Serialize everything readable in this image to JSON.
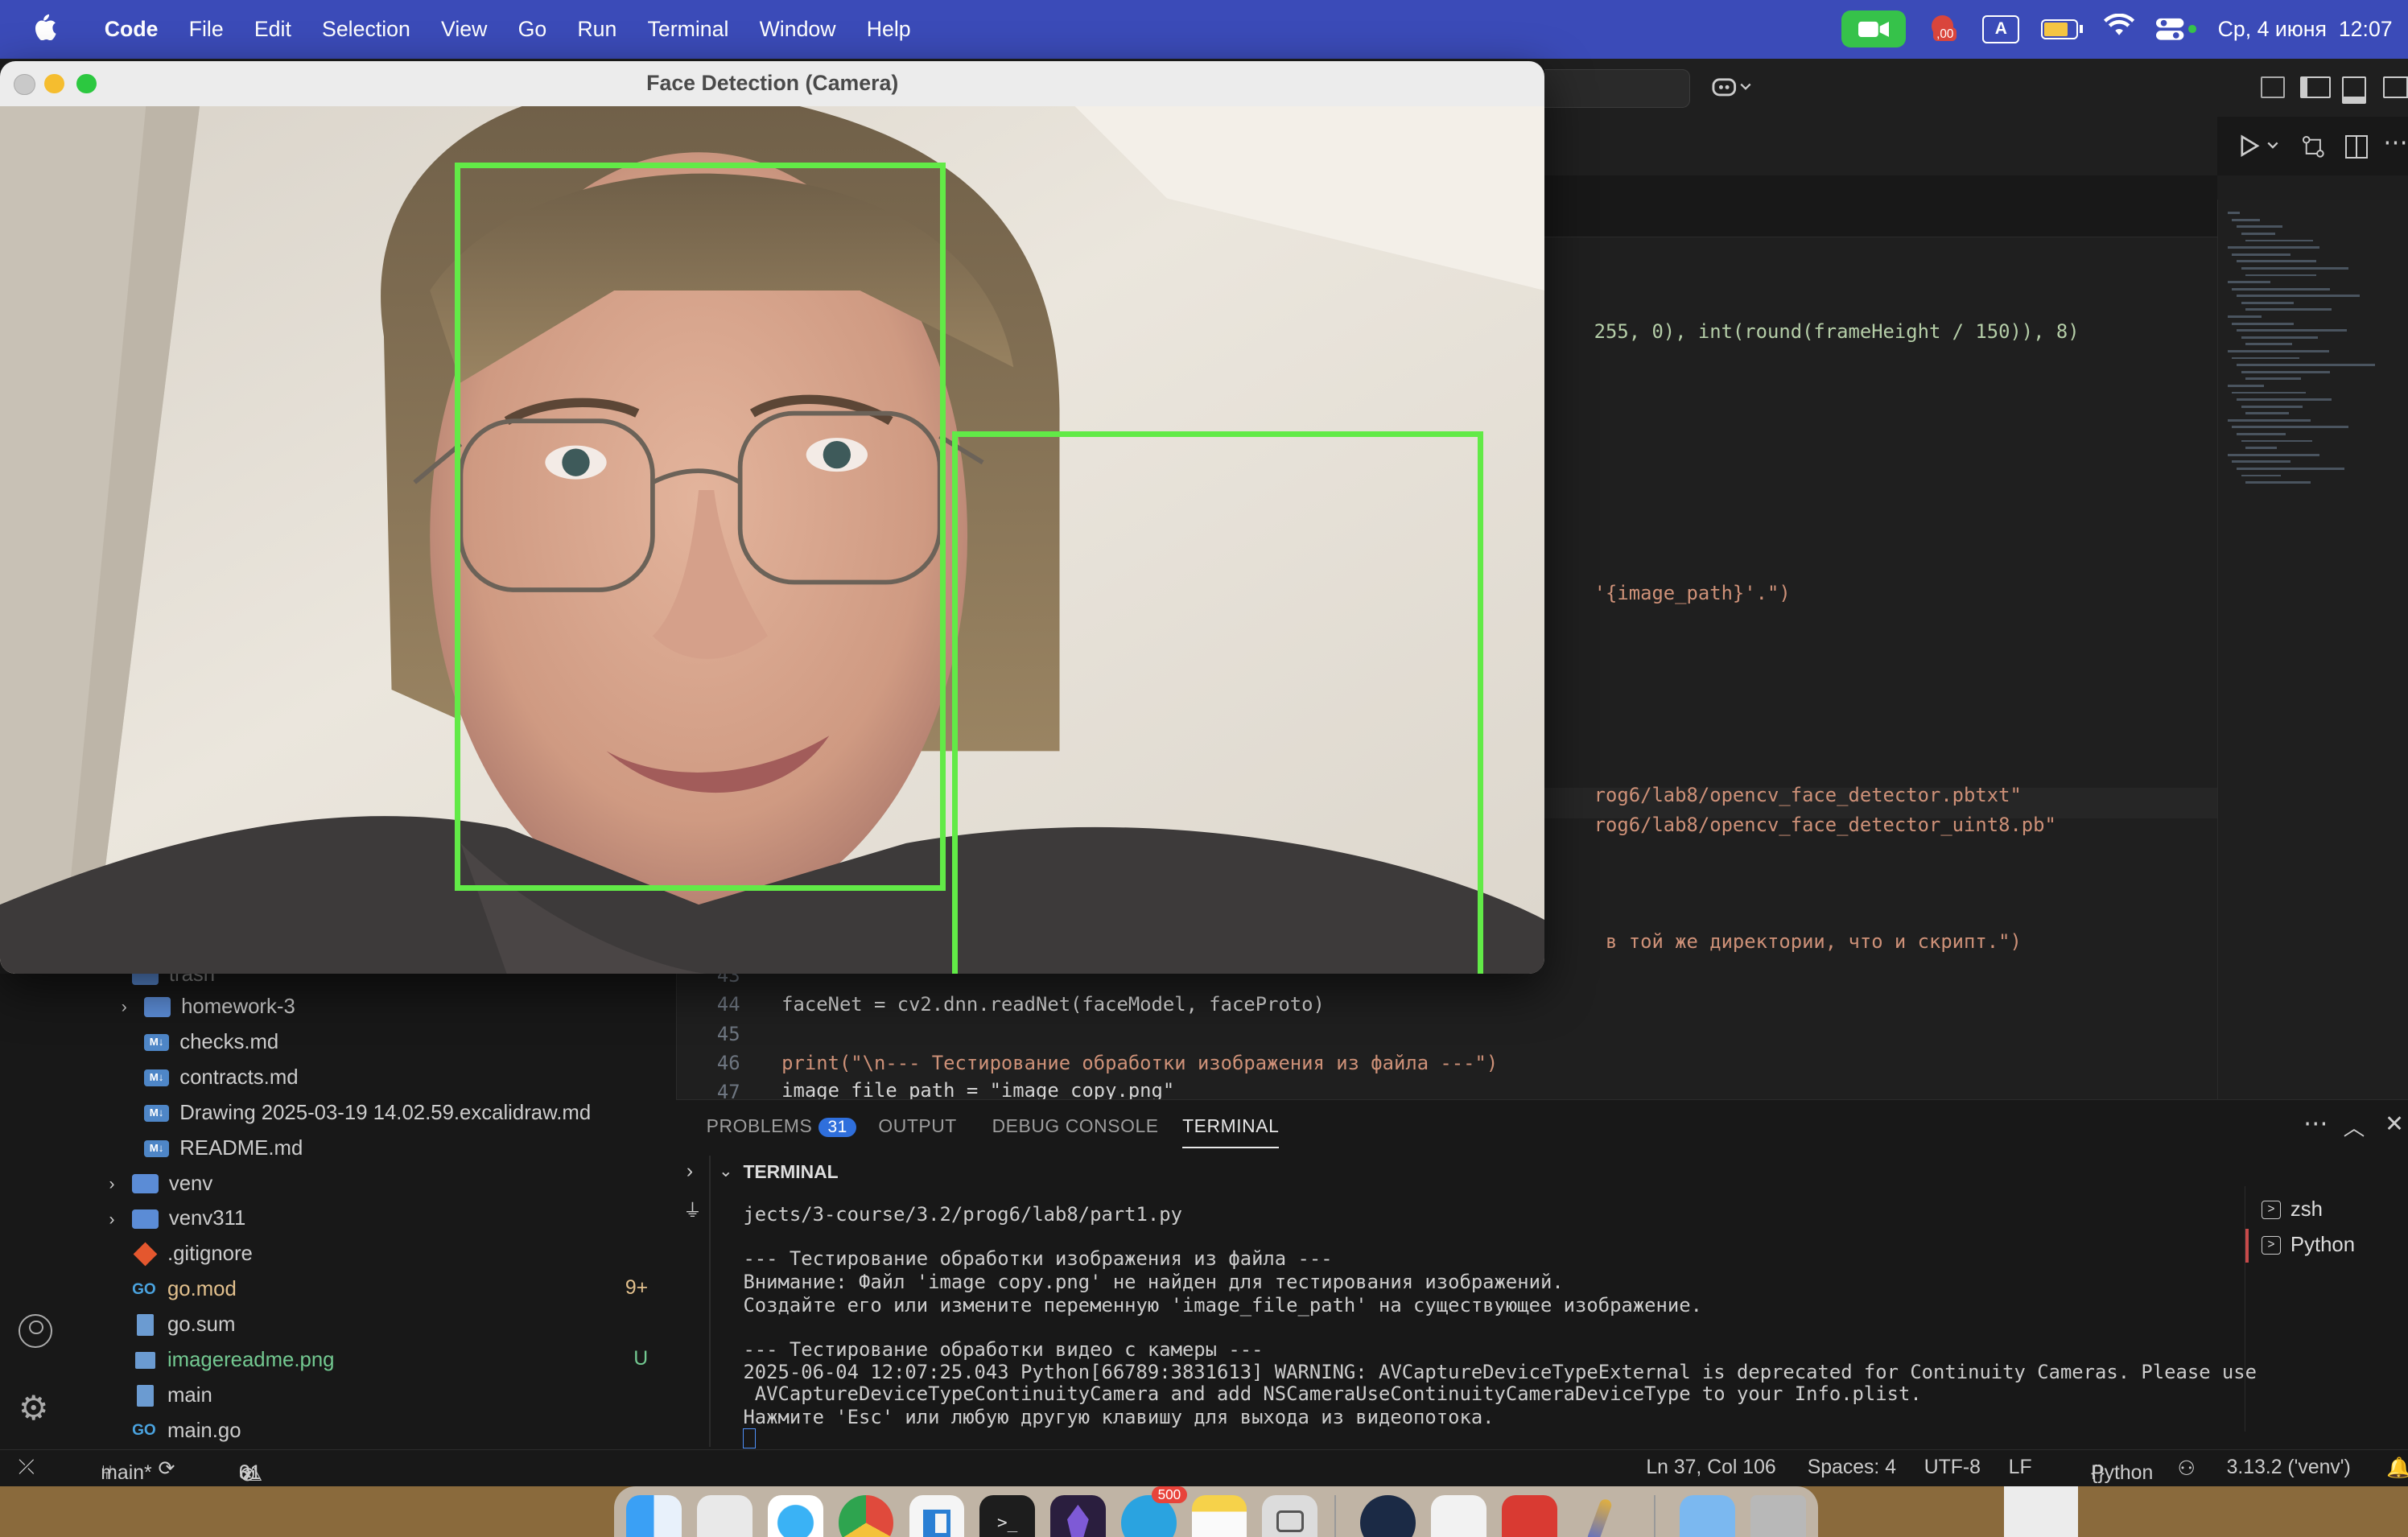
{
  "menubar": {
    "app_name": "Code",
    "items": [
      "File",
      "Edit",
      "Selection",
      "View",
      "Go",
      "Run",
      "Terminal",
      "Window",
      "Help"
    ],
    "clock": "Ср, 4 июня  12:07",
    "record_badge": ",00",
    "input_indicator": "A"
  },
  "camera_window": {
    "title": "Face Detection (Camera)"
  },
  "editor": {
    "visible_code": [
      {
        "text": "255, 0), int(round(frameHeight / 150)), 8)"
      },
      {
        "text": "'{image_path}'.\")"
      },
      {
        "text": "rog6/lab8/opencv_face_detector.pbtxt\""
      },
      {
        "text": "rog6/lab8/opencv_face_detector_uint8.pb\""
      },
      {
        "text": " в той же директории, что и скрипт.\")"
      }
    ],
    "lines": [
      {
        "num": "43",
        "text": ""
      },
      {
        "num": "44",
        "text": "faceNet = cv2.dnn.readNet(faceModel, faceProto)"
      },
      {
        "num": "45",
        "text": ""
      },
      {
        "num": "46",
        "text": "print(\"\\n--- Тестирование обработки изображения из файла ---\")"
      },
      {
        "num": "47",
        "text": "image_file_path = \"image copy.png\""
      }
    ]
  },
  "sidebar": {
    "items": [
      {
        "label": "trash",
        "type": "folder"
      },
      {
        "label": "homework-3",
        "type": "folder"
      },
      {
        "label": "checks.md",
        "type": "md"
      },
      {
        "label": "contracts.md",
        "type": "md"
      },
      {
        "label": "Drawing 2025-03-19 14.02.59.excalidraw.md",
        "type": "md"
      },
      {
        "label": "README.md",
        "type": "md"
      },
      {
        "label": "venv",
        "type": "folder"
      },
      {
        "label": "venv311",
        "type": "folder"
      },
      {
        "label": ".gitignore",
        "type": "git"
      },
      {
        "label": "go.mod",
        "type": "go",
        "decoration": "9+"
      },
      {
        "label": "go.sum",
        "type": "file"
      },
      {
        "label": "imagereadme.png",
        "type": "image",
        "decoration": "U"
      },
      {
        "label": "main",
        "type": "file"
      },
      {
        "label": "main.go",
        "type": "go"
      }
    ]
  },
  "panel": {
    "tabs": [
      "PROBLEMS",
      "OUTPUT",
      "DEBUG CONSOLE",
      "TERMINAL"
    ],
    "problems_count": "31",
    "section_title": "TERMINAL",
    "terminal_lines": [
      "jects/3-course/3.2/prog6/lab8/part1.py",
      "",
      "--- Тестирование обработки изображения из файла ---",
      "Внимание: Файл 'image copy.png' не найден для тестирования изображений.",
      "Создайте его или измените переменную 'image_file_path' на существующее изображение.",
      "",
      "--- Тестирование обработки видео с камеры ---",
      "2025-06-04 12:07:25.043 Python[66789:3831613] WARNING: AVCaptureDeviceTypeExternal is deprecated for Continuity Cameras. Please use",
      " AVCaptureDeviceTypeContinuityCamera and add NSCameraUseContinuityCameraDeviceType to your Info.plist.",
      "Нажмите 'Esc' или любую другую клавишу для выхода из видеопотока."
    ],
    "terminals": [
      "zsh",
      "Python"
    ]
  },
  "statusbar": {
    "branch": "main*",
    "errors": "0",
    "warnings": "31",
    "cursor": "Ln 37, Col 106",
    "spaces": "Spaces: 4",
    "encoding": "UTF-8",
    "eol": "LF",
    "language": "Python",
    "interpreter": "3.13.2 ('venv')"
  },
  "dock": {
    "telegram_badge": "500"
  },
  "colors": {
    "menubar": "#3b4bb8",
    "detection_box": "#62ea47",
    "git_untracked": "#73c991",
    "git_modified": "#e2c08d"
  }
}
